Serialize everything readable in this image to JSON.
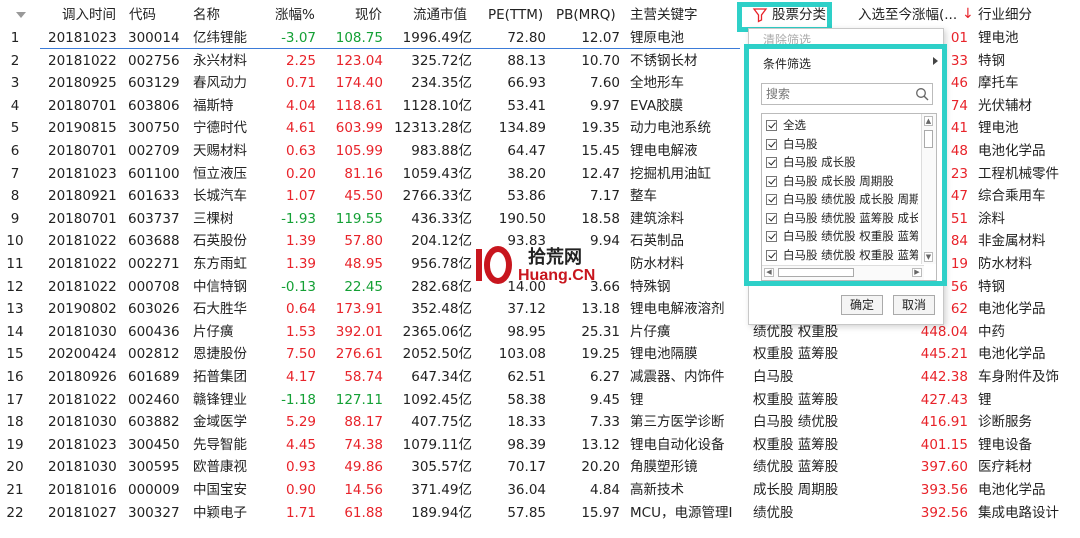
{
  "table": {
    "columns": [
      "调入时间",
      "代码",
      "名称",
      "涨幅%",
      "现价",
      "流通市值",
      "PE(TTM)",
      "PB(MRQ)",
      "主营关键字",
      "股票分类",
      "入选至今涨幅(...",
      "行业细分"
    ],
    "rows": [
      {
        "no": "1",
        "date": "20181023",
        "code": "300014",
        "name": "亿纬锂能",
        "chg": "-3.07",
        "price": "108.75",
        "mcap": "1996.49亿",
        "pe": "72.80",
        "pb": "12.07",
        "kw": "锂原电池",
        "cat": "",
        "since": "01",
        "ind": "锂电池"
      },
      {
        "no": "2",
        "date": "20181022",
        "code": "002756",
        "name": "永兴材料",
        "chg": "2.25",
        "price": "123.04",
        "mcap": "325.72亿",
        "pe": "88.13",
        "pb": "10.70",
        "kw": "不锈钢长材",
        "cat": "",
        "since": "33",
        "ind": "特钢"
      },
      {
        "no": "3",
        "date": "20180925",
        "code": "603129",
        "name": "春风动力",
        "chg": "0.71",
        "price": "174.40",
        "mcap": "234.35亿",
        "pe": "66.93",
        "pb": "7.60",
        "kw": "全地形车",
        "cat": "",
        "since": "46",
        "ind": "摩托车"
      },
      {
        "no": "4",
        "date": "20180701",
        "code": "603806",
        "name": "福斯特",
        "chg": "4.04",
        "price": "118.61",
        "mcap": "1128.10亿",
        "pe": "53.41",
        "pb": "9.97",
        "kw": "EVA胶膜",
        "cat": "",
        "since": "74",
        "ind": "光伏辅材"
      },
      {
        "no": "5",
        "date": "20190815",
        "code": "300750",
        "name": "宁德时代",
        "chg": "4.61",
        "price": "603.99",
        "mcap": "12313.28亿",
        "pe": "134.89",
        "pb": "19.35",
        "kw": "动力电池系统",
        "cat": "",
        "since": "41",
        "ind": "锂电池"
      },
      {
        "no": "6",
        "date": "20180701",
        "code": "002709",
        "name": "天赐材料",
        "chg": "0.63",
        "price": "105.99",
        "mcap": "983.88亿",
        "pe": "64.47",
        "pb": "15.45",
        "kw": "锂电电解液",
        "cat": "",
        "since": "48",
        "ind": "电池化学品"
      },
      {
        "no": "7",
        "date": "20181023",
        "code": "601100",
        "name": "恒立液压",
        "chg": "0.20",
        "price": "81.16",
        "mcap": "1059.43亿",
        "pe": "38.20",
        "pb": "12.47",
        "kw": "挖掘机用油缸",
        "cat": "",
        "since": "23",
        "ind": "工程机械零件"
      },
      {
        "no": "8",
        "date": "20180921",
        "code": "601633",
        "name": "长城汽车",
        "chg": "1.07",
        "price": "45.50",
        "mcap": "2766.33亿",
        "pe": "53.86",
        "pb": "7.17",
        "kw": "整车",
        "cat": "",
        "since": "47",
        "ind": "综合乘用车"
      },
      {
        "no": "9",
        "date": "20180701",
        "code": "603737",
        "name": "三棵树",
        "chg": "-1.93",
        "price": "119.55",
        "mcap": "436.33亿",
        "pe": "190.50",
        "pb": "18.58",
        "kw": "建筑涂料",
        "cat": "",
        "since": "51",
        "ind": "涂料"
      },
      {
        "no": "10",
        "date": "20181022",
        "code": "603688",
        "name": "石英股份",
        "chg": "1.39",
        "price": "57.80",
        "mcap": "204.12亿",
        "pe": "93.83",
        "pb": "9.94",
        "kw": "石英制品",
        "cat": "",
        "since": "84",
        "ind": "非金属材料"
      },
      {
        "no": "11",
        "date": "20181022",
        "code": "002271",
        "name": "东方雨虹",
        "chg": "1.39",
        "price": "48.95",
        "mcap": "956.78亿",
        "pe": "",
        "pb": "",
        "kw": "防水材料",
        "cat": "",
        "since": "19",
        "ind": "防水材料"
      },
      {
        "no": "12",
        "date": "20181022",
        "code": "000708",
        "name": "中信特钢",
        "chg": "-0.13",
        "price": "22.45",
        "mcap": "282.68亿",
        "pe": "14.00",
        "pb": "3.66",
        "kw": "特殊钢",
        "cat": "",
        "since": "56",
        "ind": "特钢"
      },
      {
        "no": "13",
        "date": "20190802",
        "code": "603026",
        "name": "石大胜华",
        "chg": "0.64",
        "price": "173.91",
        "mcap": "352.48亿",
        "pe": "37.12",
        "pb": "13.18",
        "kw": "锂电电解液溶剂",
        "cat": "",
        "since": "62",
        "ind": "电池化学品"
      },
      {
        "no": "14",
        "date": "20181030",
        "code": "600436",
        "name": "片仔癀",
        "chg": "1.53",
        "price": "392.01",
        "mcap": "2365.06亿",
        "pe": "98.95",
        "pb": "25.31",
        "kw": "片仔癀",
        "cat": "绩优股 权重股",
        "since": "448.04",
        "ind": "中药"
      },
      {
        "no": "15",
        "date": "20200424",
        "code": "002812",
        "name": "恩捷股份",
        "chg": "7.50",
        "price": "276.61",
        "mcap": "2052.50亿",
        "pe": "103.08",
        "pb": "19.25",
        "kw": "锂电池隔膜",
        "cat": "权重股 蓝筹股",
        "since": "445.21",
        "ind": "电池化学品"
      },
      {
        "no": "16",
        "date": "20180926",
        "code": "601689",
        "name": "拓普集团",
        "chg": "4.17",
        "price": "58.74",
        "mcap": "647.34亿",
        "pe": "62.51",
        "pb": "6.27",
        "kw": "减震器、内饰件",
        "cat": "白马股",
        "since": "442.38",
        "ind": "车身附件及饰"
      },
      {
        "no": "17",
        "date": "20181022",
        "code": "002460",
        "name": "赣锋锂业",
        "chg": "-1.18",
        "price": "127.11",
        "mcap": "1092.45亿",
        "pe": "58.38",
        "pb": "9.45",
        "kw": "锂",
        "cat": "权重股 蓝筹股",
        "since": "427.43",
        "ind": "锂"
      },
      {
        "no": "18",
        "date": "20181030",
        "code": "603882",
        "name": "金域医学",
        "chg": "5.29",
        "price": "88.17",
        "mcap": "407.75亿",
        "pe": "18.33",
        "pb": "7.33",
        "kw": "第三方医学诊断",
        "cat": "白马股 绩优股",
        "since": "416.91",
        "ind": "诊断服务"
      },
      {
        "no": "19",
        "date": "20181023",
        "code": "300450",
        "name": "先导智能",
        "chg": "4.45",
        "price": "74.38",
        "mcap": "1079.11亿",
        "pe": "98.39",
        "pb": "13.12",
        "kw": "锂电自动化设备",
        "cat": "权重股 蓝筹股",
        "since": "401.15",
        "ind": "锂电设备"
      },
      {
        "no": "20",
        "date": "20181030",
        "code": "300595",
        "name": "欧普康视",
        "chg": "0.93",
        "price": "49.86",
        "mcap": "305.57亿",
        "pe": "70.17",
        "pb": "20.20",
        "kw": "角膜塑形镜",
        "cat": "绩优股 蓝筹股",
        "since": "397.60",
        "ind": "医疗耗材"
      },
      {
        "no": "21",
        "date": "20181016",
        "code": "000009",
        "name": "中国宝安",
        "chg": "0.90",
        "price": "14.56",
        "mcap": "371.49亿",
        "pe": "36.04",
        "pb": "4.84",
        "kw": "高新技术",
        "cat": "成长股 周期股",
        "since": "393.56",
        "ind": "电池化学品"
      },
      {
        "no": "22",
        "date": "20181027",
        "code": "300327",
        "name": "中颖电子",
        "chg": "1.71",
        "price": "61.88",
        "mcap": "189.94亿",
        "pe": "57.85",
        "pb": "15.97",
        "kw": "MCU，电源管理I",
        "cat": "绩优股",
        "since": "392.56",
        "ind": "集成电路设计"
      }
    ]
  },
  "popup": {
    "clear_filter": "清除筛选",
    "condition_filter": "条件筛选",
    "search_placeholder": "搜索",
    "options": [
      "全选",
      "白马股",
      "白马股 成长股",
      "白马股 成长股 周期股",
      "白马股 绩优股 成长股 周期股",
      "白马股 绩优股 蓝筹股 成长股",
      "白马股 绩优股 权重股 蓝筹股",
      "白马股 绩优股 权重股 蓝筹股"
    ],
    "ok_label": "确定",
    "cancel_label": "取消"
  },
  "watermark": {
    "logo_text": "10",
    "text1": "拾荒网",
    "text2": "Huang.CN"
  },
  "colors": {
    "up": "#e8232a",
    "down": "#14a035",
    "highlight": "#2ed0c8",
    "selection_line": "#3b7bd8"
  }
}
